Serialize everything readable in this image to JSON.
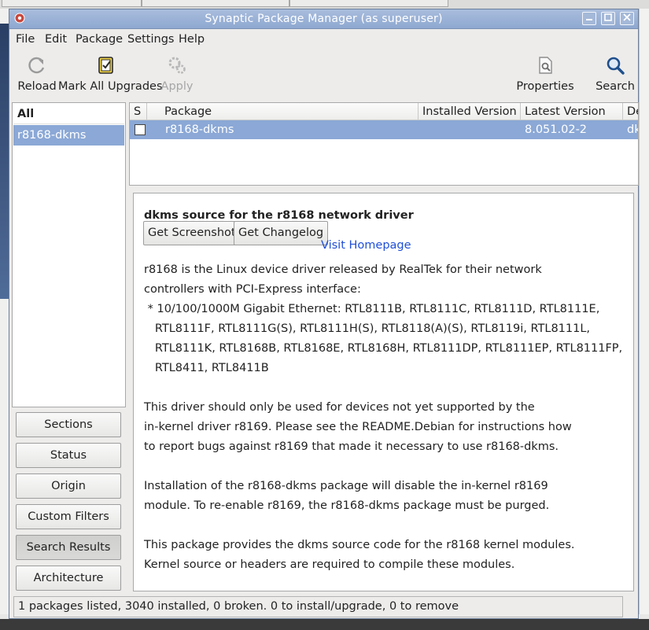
{
  "window": {
    "title": "Synaptic Package Manager  (as superuser)",
    "controls": [
      "minimize",
      "maximize",
      "close"
    ]
  },
  "menubar": [
    "File",
    "Edit",
    "Package",
    "Settings",
    "Help"
  ],
  "toolbar": {
    "reload": "Reload",
    "mark_all_upgrades": "Mark All Upgrades",
    "apply": "Apply",
    "properties": "Properties",
    "search": "Search"
  },
  "filters": {
    "header": "All",
    "items": [
      "r8168-dkms"
    ]
  },
  "side_buttons": [
    "Sections",
    "Status",
    "Origin",
    "Custom Filters",
    "Search Results",
    "Architecture"
  ],
  "package_table": {
    "columns": [
      "S",
      "Package",
      "Installed Version",
      "Latest Version",
      "De"
    ],
    "rows": [
      {
        "status": "",
        "package": "r8168-dkms",
        "installed": "",
        "latest": "8.051.02-2",
        "description": "dk"
      }
    ]
  },
  "details": {
    "title": "dkms source for the r8168 network driver",
    "buttons": [
      "Get Screenshot",
      "Get Changelog"
    ],
    "link": "Visit Homepage",
    "lines": [
      "r8168 is the Linux device driver released by RealTek for their network",
      "controllers with PCI-Express interface:",
      " * 10/100/1000M Gigabit Ethernet: RTL8111B, RTL8111C, RTL8111D, RTL8111E,",
      "   RTL8111F, RTL8111G(S), RTL8111H(S), RTL8118(A)(S), RTL8119i, RTL8111L,",
      "   RTL8111K, RTL8168B, RTL8168E, RTL8168H, RTL8111DP, RTL8111EP, RTL8111FP,",
      "   RTL8411, RTL8411B",
      "",
      "This driver should only be used for devices not yet supported by the",
      "in-kernel driver r8169. Please see the README.Debian for instructions how",
      "to report bugs against r8169 that made it necessary to use r8168-dkms.",
      "",
      "Installation of the r8168-dkms package will disable the in-kernel r8169",
      "module. To re-enable r8169, the r8168-dkms package must be purged.",
      "",
      "This package provides the dkms source code for the r8168 kernel modules.",
      "Kernel source or headers are required to compile these modules."
    ]
  },
  "status_text": "1 packages listed, 3040 installed, 0 broken. 0 to install/upgrade, 0 to remove",
  "colors": {
    "titlebar": "#9bb2d6",
    "selection": "#8ba8d6",
    "link": "#1f4fd6",
    "disabled_text": "#a6a6a6"
  }
}
